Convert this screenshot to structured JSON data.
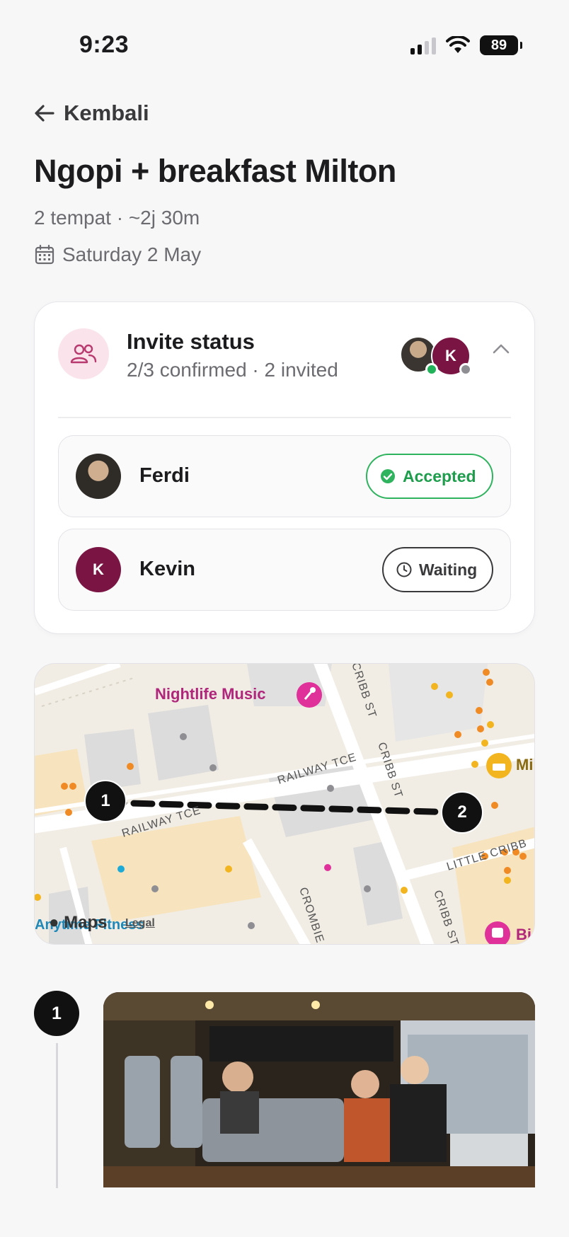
{
  "status_bar": {
    "time": "9:23",
    "battery": "89"
  },
  "nav": {
    "back_label": "Kembali"
  },
  "page": {
    "title": "Ngopi + breakfast Milton",
    "meta": "2 tempat · ~2j 30m",
    "date": "Saturday 2 May"
  },
  "invite": {
    "title": "Invite status",
    "subtitle": "2/3 confirmed · 2 invited",
    "avatar_initial": "K",
    "people": [
      {
        "name": "Ferdi",
        "status": "Accepted",
        "status_color": "#2fb35e"
      },
      {
        "name": "Kevin",
        "initial": "K",
        "status": "Waiting",
        "status_color": "#3a3a3c"
      }
    ]
  },
  "map": {
    "streets": [
      "RAILWAY TCE",
      "RAILWAY TCE",
      "CRIBB ST",
      "CRIBB ST",
      "CRIBB ST",
      "CROMBIE S",
      "LITTLE CRIBB"
    ],
    "poi": "Nightlife Music",
    "poi_right": "Mi",
    "poi_bottom": "Bi",
    "attribution_maps": "Maps",
    "attribution_legal": "Legal",
    "attribution_gym": "Anytime Fitness",
    "stops": [
      "1",
      "2"
    ]
  },
  "stops": [
    {
      "number": "1"
    }
  ],
  "colors": {
    "accent": "#7a1442",
    "accepted": "#2fb35e",
    "map_bg": "#f1ede4"
  }
}
